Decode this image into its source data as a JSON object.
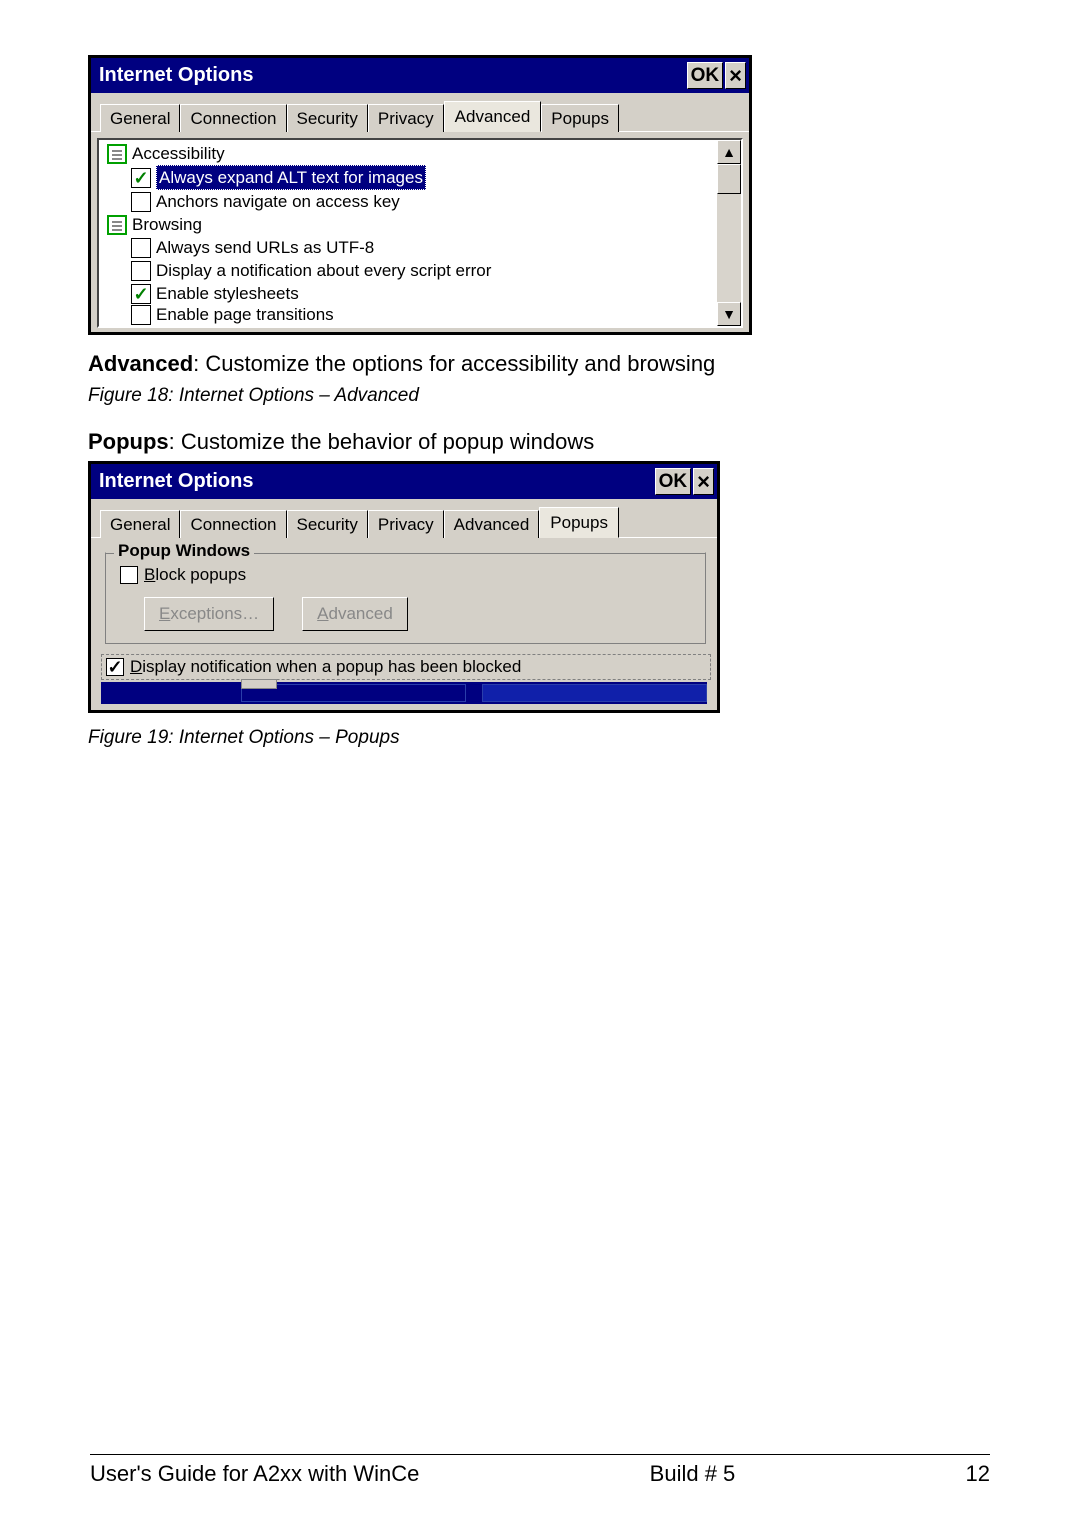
{
  "dialog_advanced": {
    "title": "Internet Options",
    "ok_label": "OK",
    "close_label": "×",
    "tabs": [
      "General",
      "Connection",
      "Security",
      "Privacy",
      "Advanced",
      "Popups"
    ],
    "active_tab": "Advanced",
    "tree": {
      "group1": "Accessibility",
      "item1": "Always expand ALT text for images",
      "item1_checked": true,
      "item1_selected": true,
      "item2": "Anchors navigate on access key",
      "item2_checked": false,
      "group2": "Browsing",
      "item3": "Always send URLs as UTF-8",
      "item3_checked": false,
      "item4": "Display a notification about every script error",
      "item4_checked": false,
      "item5": "Enable stylesheets",
      "item5_checked": true,
      "item6": "Enable page transitions",
      "item6_checked": false
    }
  },
  "caption_adv_bold": "Advanced",
  "caption_adv_rest": ": Customize the options for accessibility and browsing",
  "figure_adv": "Figure 18: Internet Options – Advanced",
  "caption_pop_bold": "Popups",
  "caption_pop_rest": ": Customize the behavior of popup windows",
  "dialog_popups": {
    "title": "Internet Options",
    "ok_label": "OK",
    "close_label": "×",
    "tabs": [
      "General",
      "Connection",
      "Security",
      "Privacy",
      "Advanced",
      "Popups"
    ],
    "active_tab": "Popups",
    "fieldset_legend": "Popup Windows",
    "block_label": "Block popups",
    "block_checked": false,
    "exceptions_label": "Exceptions…",
    "advanced_label": "Advanced",
    "display_notif": "Display notification when a popup has been blocked",
    "display_notif_checked": true
  },
  "figure_pop": "Figure 19: Internet Options – Popups",
  "footer_left": "User's Guide for A2xx with WinCe",
  "footer_center": "Build # 5",
  "footer_right": "12"
}
